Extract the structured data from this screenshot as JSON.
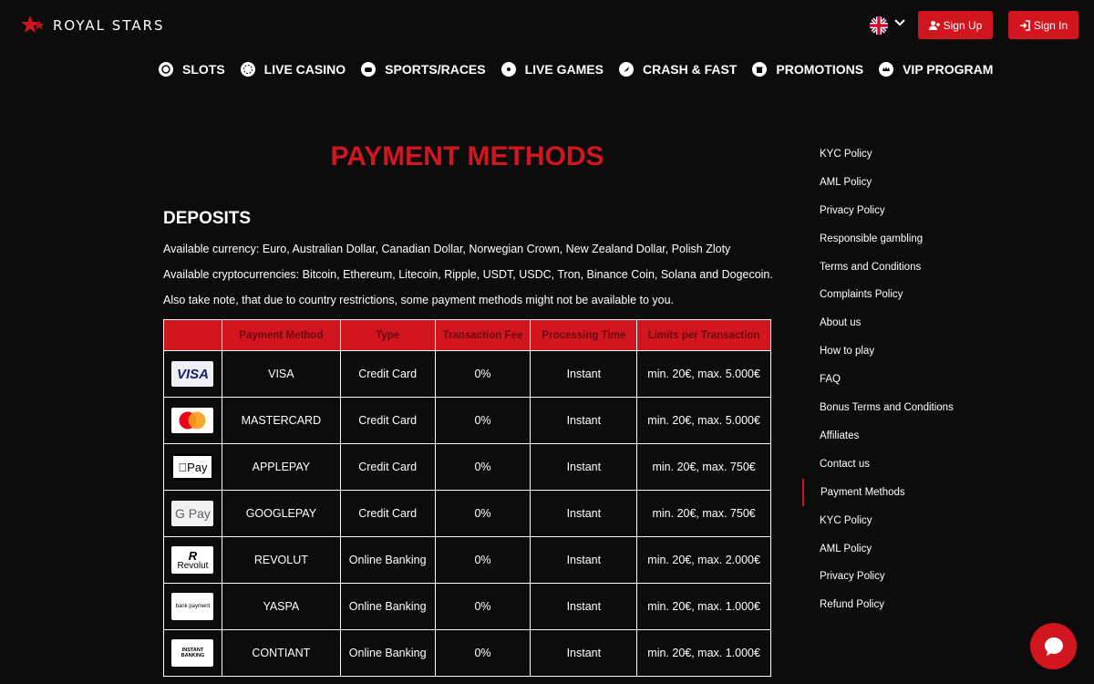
{
  "header": {
    "logo_text": "ROYAL STARS",
    "signup_label": "Sign Up",
    "signin_label": "Sign In"
  },
  "nav": {
    "items": [
      {
        "label": "SLOTS",
        "icon": "slots-icon"
      },
      {
        "label": "LIVE CASINO",
        "icon": "live-casino-icon"
      },
      {
        "label": "SPORTS/RACES",
        "icon": "sports-icon"
      },
      {
        "label": "LIVE GAMES",
        "icon": "live-games-icon"
      },
      {
        "label": "CRASH & FAST",
        "icon": "rocket-icon"
      },
      {
        "label": "PROMOTIONS",
        "icon": "gift-icon"
      },
      {
        "label": "VIP PROGRAM",
        "icon": "crown-icon"
      }
    ]
  },
  "main": {
    "title": "PAYMENT METHODS",
    "section_title": "DEPOSITS",
    "p1": "Available currency: Euro, Australian Dollar, Canadian Dollar, Norwegian Crown, New Zealand Dollar, Polish Zloty",
    "p2": "Available cryptocurrencies: Bitcoin, Ethereum, Litecoin, Ripple, USDT, USDC, Tron, Binance Coin, Solana and Dogecoin.",
    "p3": "Also take note, that due to country restrictions, some payment methods might not be available to you.",
    "table": {
      "headers": [
        "",
        "Payment Method",
        "Type",
        "Transaction Fee",
        "Processing Time",
        "Limits per Transaction"
      ],
      "rows": [
        {
          "logo": "VISA",
          "method": "VISA",
          "type": "Credit Card",
          "fee": "0%",
          "time": "Instant",
          "limits": "min. 20€, max. 5.000€"
        },
        {
          "logo": "mastercard",
          "method": "MASTERCARD",
          "type": "Credit Card",
          "fee": "0%",
          "time": "Instant",
          "limits": "min. 20€, max. 5.000€"
        },
        {
          "logo": "Pay",
          "method": "APPLEPAY",
          "type": "Credit Card",
          "fee": "0%",
          "time": "Instant",
          "limits": "min. 20€, max. 750€"
        },
        {
          "logo": "G Pay",
          "method": "GOOGLEPAY",
          "type": "Credit Card",
          "fee": "0%",
          "time": "Instant",
          "limits": "min. 20€, max. 750€"
        },
        {
          "logo": "Revolut",
          "method": "REVOLUT",
          "type": "Online Banking",
          "fee": "0%",
          "time": "Instant",
          "limits": "min. 20€, max. 2.000€"
        },
        {
          "logo": "bank payment",
          "method": "YASPA",
          "type": "Online Banking",
          "fee": "0%",
          "time": "Instant",
          "limits": "min. 20€, max. 1.000€"
        },
        {
          "logo": "INSTANT BANKING",
          "method": "CONTIANT",
          "type": "Online Banking",
          "fee": "0%",
          "time": "Instant",
          "limits": "min. 20€, max. 1.000€"
        }
      ]
    }
  },
  "sidebar": {
    "items": [
      "KYC Policy",
      "AML Policy",
      "Privacy Policy",
      "Responsible gambling",
      "Terms and Conditions",
      "Complaints Policy",
      "About us",
      "How to play",
      "FAQ",
      "Bonus Terms and Conditions",
      "Affiliates",
      "Contact us",
      "Payment Methods",
      "KYC Policy",
      "AML Policy",
      "Privacy Policy",
      "Refund Policy"
    ],
    "active_index": 12
  },
  "colors": {
    "accent": "#d2161f",
    "background": "#0c0c0d"
  }
}
